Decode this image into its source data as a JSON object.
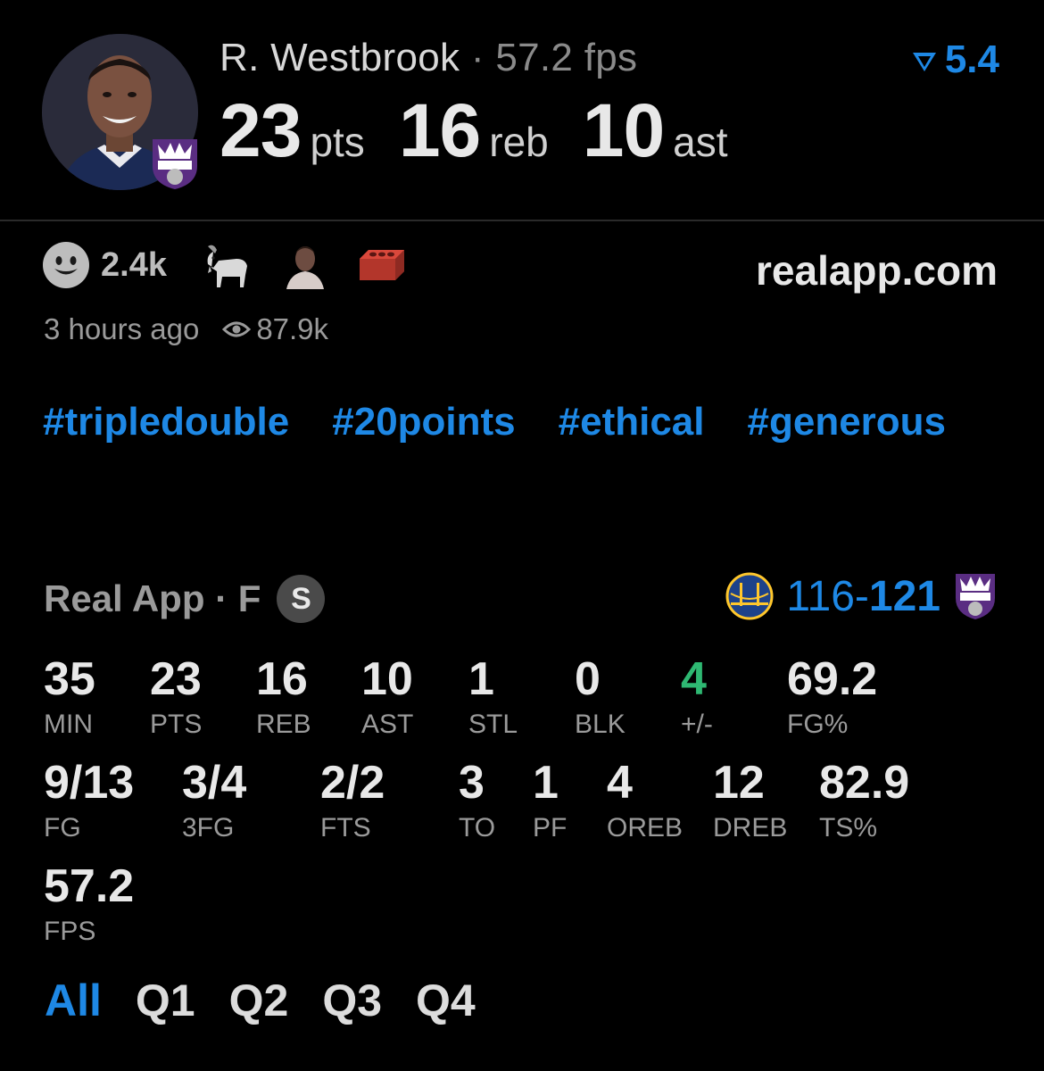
{
  "player": {
    "name": "R. Westbrook",
    "separator": "·",
    "fps_text": "57.2 fps",
    "rating": "5.4",
    "headline": [
      {
        "value": "23",
        "unit": "pts"
      },
      {
        "value": "16",
        "unit": "reb"
      },
      {
        "value": "10",
        "unit": "ast"
      }
    ]
  },
  "reactions": {
    "count": "2.4k",
    "emojis": [
      "goat-emoji",
      "player-reaction-icon",
      "brick-emoji"
    ],
    "site": "realapp.com",
    "time_ago": "3 hours ago",
    "views": "87.9k"
  },
  "hashtags": [
    "#tripledouble",
    "#20points",
    "#ethical",
    "#generous"
  ],
  "game": {
    "source": "Real App · F",
    "badge": "S",
    "score_left": "116-",
    "score_right": "121"
  },
  "stats": {
    "row1": [
      {
        "value": "35",
        "label": "MIN"
      },
      {
        "value": "23",
        "label": "PTS"
      },
      {
        "value": "16",
        "label": "REB"
      },
      {
        "value": "10",
        "label": "AST"
      },
      {
        "value": "1",
        "label": "STL"
      },
      {
        "value": "0",
        "label": "BLK"
      },
      {
        "value": "4",
        "label": "+/-"
      },
      {
        "value": "69.2",
        "label": "FG%"
      }
    ],
    "row2": [
      {
        "value": "9/13",
        "label": "FG"
      },
      {
        "value": "3/4",
        "label": "3FG"
      },
      {
        "value": "2/2",
        "label": "FTS"
      },
      {
        "value": "3",
        "label": "TO"
      },
      {
        "value": "1",
        "label": "PF"
      },
      {
        "value": "4",
        "label": "OREB"
      },
      {
        "value": "12",
        "label": "DREB"
      },
      {
        "value": "82.9",
        "label": "TS%"
      }
    ],
    "row3": [
      {
        "value": "57.2",
        "label": "FPS"
      }
    ]
  },
  "quarters": [
    "All",
    "Q1",
    "Q2",
    "Q3",
    "Q4"
  ],
  "colors": {
    "accent": "#1e88e5",
    "positive": "#2eb872",
    "background": "#000000"
  }
}
